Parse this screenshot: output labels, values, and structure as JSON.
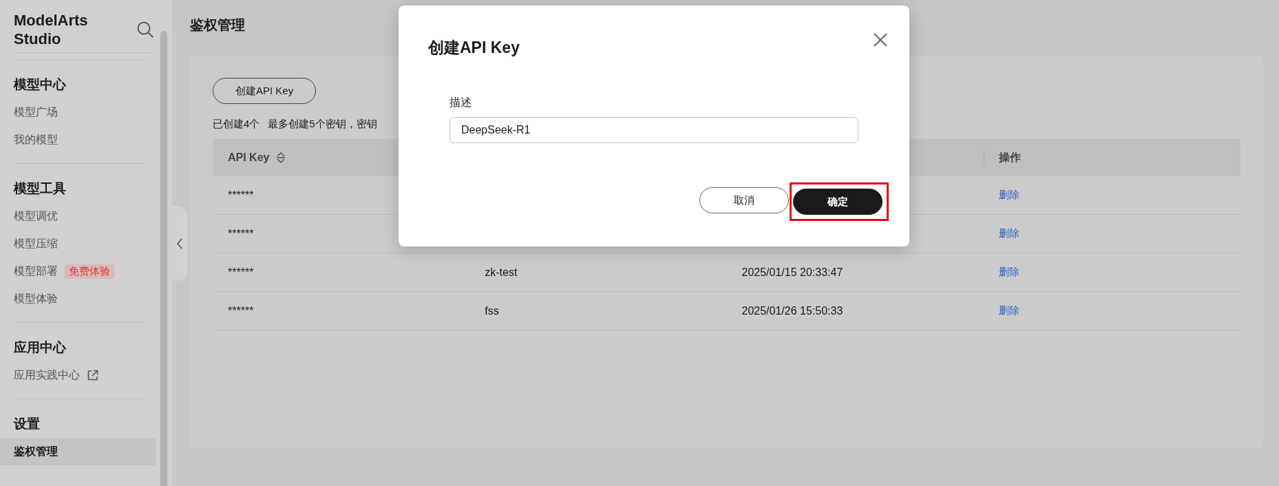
{
  "sidebar": {
    "title": "ModelArts Studio",
    "sections": [
      {
        "heading": "模型中心",
        "items": [
          {
            "label": "模型广场",
            "kind": "page",
            "selected": false
          },
          {
            "label": "我的模型",
            "kind": "page",
            "selected": false
          }
        ]
      },
      {
        "heading": "模型工具",
        "items": [
          {
            "label": "模型调优",
            "kind": "page",
            "selected": false
          },
          {
            "label": "模型压缩",
            "kind": "page",
            "selected": false
          },
          {
            "label": "模型部署",
            "kind": "page",
            "selected": false,
            "badge": "免费体验"
          },
          {
            "label": "模型体验",
            "kind": "page",
            "selected": false
          }
        ]
      },
      {
        "heading": "应用中心",
        "items": [
          {
            "label": "应用实践中心",
            "kind": "external_link",
            "selected": false
          }
        ]
      },
      {
        "heading": "设置",
        "items": [
          {
            "label": "鉴权管理",
            "kind": "page",
            "selected": true
          }
        ]
      }
    ]
  },
  "main": {
    "title": "鉴权管理",
    "create_button": "创建API Key",
    "count_text": "已创建4个",
    "limit_text": "最多创建5个密钥，密钥",
    "table": {
      "header": {
        "column_1": "API Key",
        "column_4": "操作"
      },
      "rows": [
        {
          "column_1": "******",
          "column_4": "删除"
        },
        {
          "column_1": "******",
          "column_4": "删除"
        },
        {
          "column_1": "******",
          "column_2": "zk-test",
          "column_3": "2025/01/15 20:33:47",
          "column_4": "删除"
        },
        {
          "column_1": "******",
          "column_2": "fss",
          "column_3": "2025/01/26 15:50:33",
          "column_4": "删除"
        }
      ]
    }
  },
  "dialog": {
    "title": "创建API Key",
    "field_label": "描述",
    "field_value": "DeepSeek-R1",
    "buttons": [
      {
        "label": "取消",
        "kind": "secondary",
        "highlighted": false
      },
      {
        "label": "确定",
        "kind": "primary",
        "highlighted": true
      }
    ]
  }
}
